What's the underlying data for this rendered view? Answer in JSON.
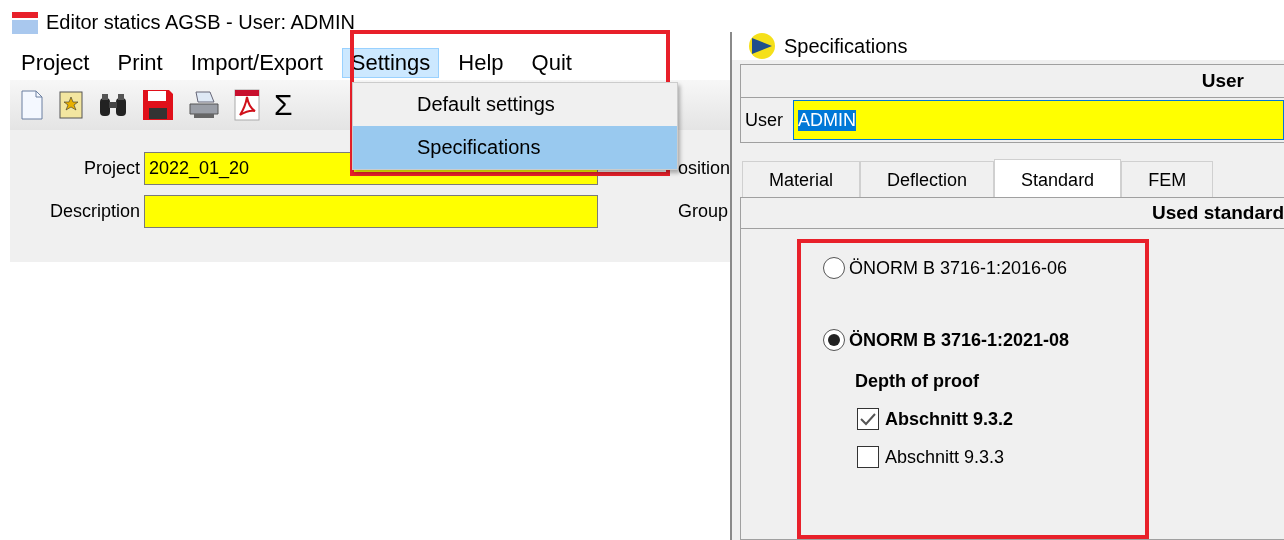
{
  "window": {
    "title": "Editor statics AGSB - User: ADMIN"
  },
  "menu_bar": [
    {
      "label": "Project",
      "selected": false
    },
    {
      "label": "Print",
      "selected": false
    },
    {
      "label": "Import/Export",
      "selected": false
    },
    {
      "label": "Settings",
      "selected": true
    },
    {
      "label": "Help",
      "selected": false
    },
    {
      "label": "Quit",
      "selected": false
    }
  ],
  "dropdown": [
    {
      "label": "Default settings",
      "selected": false
    },
    {
      "label": "Specifications",
      "selected": true
    }
  ],
  "toolbar": {
    "sum_symbol": "Σ"
  },
  "form": {
    "project_label": "Project",
    "project_value": "2022_01_20",
    "description_label": "Description",
    "position_label": "osition",
    "group_label": "Group"
  },
  "dialog": {
    "title": "Specifications",
    "user_header": "User",
    "user_label": "User",
    "user_value": "ADMIN",
    "tabs": [
      {
        "label": "Material",
        "selected": false
      },
      {
        "label": "Deflection",
        "selected": false
      },
      {
        "label": "Standard",
        "selected": true
      },
      {
        "label": "FEM",
        "selected": false
      }
    ],
    "section_header": "Used standard",
    "standards": [
      {
        "label": "ÖNORM B 3716-1:2016-06",
        "selected": false
      },
      {
        "label": "ÖNORM B 3716-1:2021-08",
        "selected": true
      }
    ],
    "depth_label": "Depth of proof",
    "sections": [
      {
        "label": "Abschnitt 9.3.2",
        "checked": true
      },
      {
        "label": "Abschnitt 9.3.3",
        "checked": false
      }
    ]
  }
}
